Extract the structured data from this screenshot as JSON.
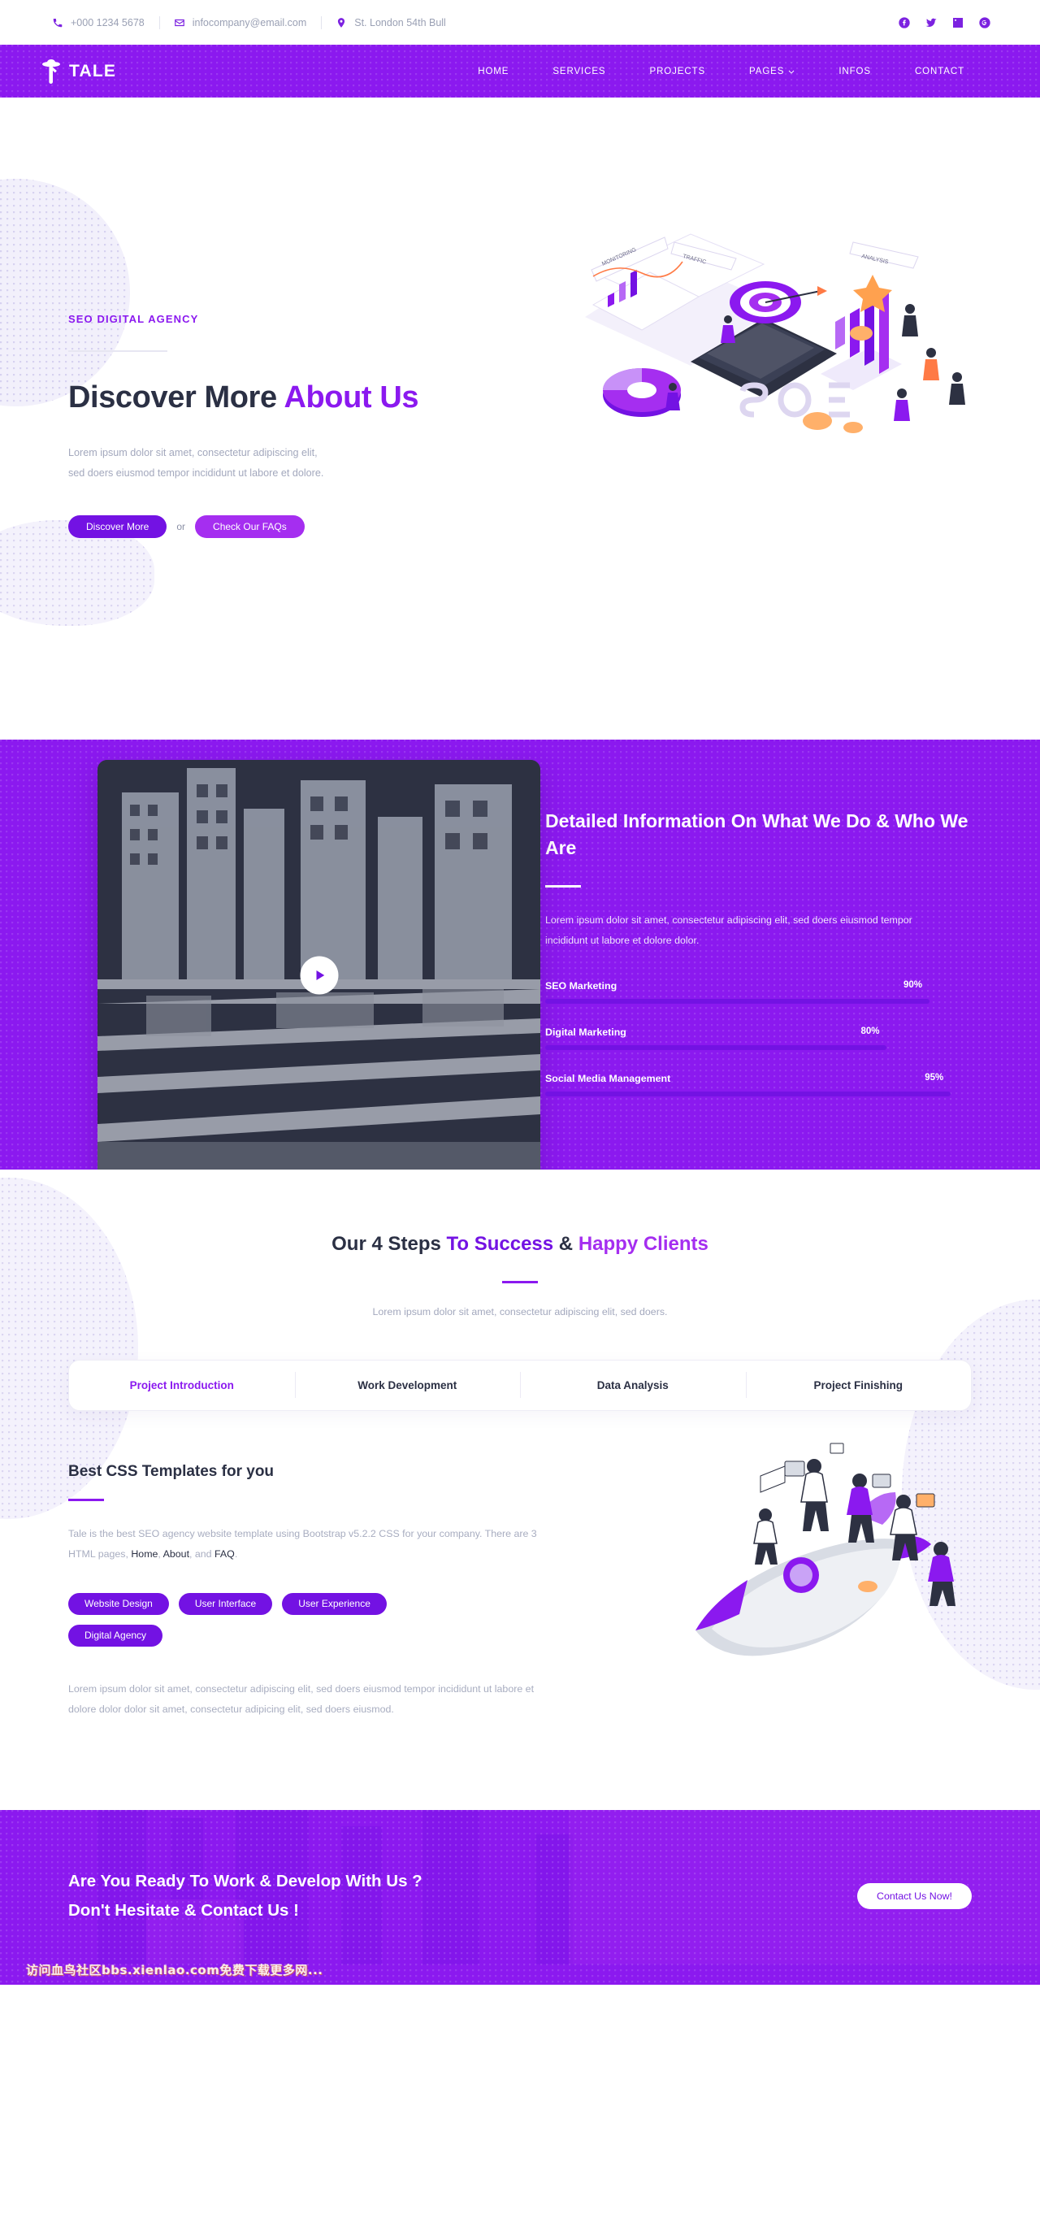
{
  "topbar": {
    "phone": "+000 1234 5678",
    "email": "infocompany@email.com",
    "address": "St. London 54th Bull",
    "socials": [
      {
        "name": "facebook-icon",
        "label": "Facebook"
      },
      {
        "name": "twitter-icon",
        "label": "Twitter"
      },
      {
        "name": "linkedin-icon",
        "label": "LinkedIn"
      },
      {
        "name": "google-plus-icon",
        "label": "Google Plus"
      }
    ]
  },
  "nav": {
    "brand": "TALE",
    "brand_icon": "hat-person-logo-icon",
    "links": [
      {
        "label": "HOME",
        "dropdown": false
      },
      {
        "label": "SERVICES",
        "dropdown": false
      },
      {
        "label": "PROJECTS",
        "dropdown": false
      },
      {
        "label": "PAGES",
        "dropdown": true
      },
      {
        "label": "INFOS",
        "dropdown": false
      },
      {
        "label": "CONTACT",
        "dropdown": false
      }
    ]
  },
  "hero": {
    "eyebrow": "SEO DIGITAL AGENCY",
    "title_plain": "Discover More ",
    "title_accent": "About Us",
    "paragraph": "Lorem ipsum dolor sit amet, consectetur adipiscing elit, sed doers eiusmod tempor incididunt ut labore et dolore.",
    "primary_button": "Discover More",
    "separator": "or",
    "secondary_button": "Check Our FAQs",
    "illustration": "seo-isometric-illustration"
  },
  "detail": {
    "title": "Detailed Information On What We Do & Who We Are",
    "paragraph": "Lorem ipsum dolor sit amet, consectetur adipiscing elit, sed doers eiusmod tempor incididunt ut labore et dolore dolor.",
    "play_icon": "play-icon",
    "video_thumb": "city-buildings-photo",
    "skills": [
      {
        "name": "SEO Marketing",
        "percent": "90%",
        "value": 90
      },
      {
        "name": "Digital Marketing",
        "percent": "80%",
        "value": 80
      },
      {
        "name": "Social Media Management",
        "percent": "95%",
        "value": 95
      }
    ]
  },
  "steps": {
    "title_p0": "Our 4 Steps ",
    "title_p1": "To Success",
    "title_mid": " & ",
    "title_p2": "Happy Clients",
    "subtitle": "Lorem ipsum dolor sit amet, consectetur adipiscing elit, sed doers.",
    "tabs": [
      {
        "label": "Project Introduction",
        "active": true
      },
      {
        "label": "Work Development",
        "active": false
      },
      {
        "label": "Data Analysis",
        "active": false
      },
      {
        "label": "Project Finishing",
        "active": false
      }
    ],
    "panel": {
      "title": "Best CSS Templates for you",
      "text_a": "Tale is the best SEO agency website template using Bootstrap v5.2.2 CSS for your company. There are 3 HTML pages, ",
      "link_home": "Home",
      "text_b": ", ",
      "link_about": "About",
      "text_c": ", and ",
      "link_faq": "FAQ",
      "text_d": ".",
      "pills": [
        "Website Design",
        "User Interface",
        "User Experience",
        "Digital Agency"
      ],
      "text_2": "Lorem ipsum dolor sit amet, consectetur adipiscing elit, sed doers eiusmod tempor incididunt ut labore et dolore dolor dolor sit amet, consectetur adipicing elit, sed doers eiusmod.",
      "illustration": "rocket-business-team-illustration"
    }
  },
  "cta": {
    "line1": "Are You Ready To Work & Develop With Us ?",
    "line2": "Don't Hesitate & Contact Us !",
    "button": "Contact Us Now!",
    "watermark": "访问血鸟社区bbs.xienlao.com免费下载更多网..."
  },
  "colors": {
    "brand_purple": "#8b19ef",
    "deep_purple": "#7312e3",
    "light_purple": "#a52ef0",
    "dark_text": "#2b3044",
    "muted_text": "#a3a8bd"
  }
}
